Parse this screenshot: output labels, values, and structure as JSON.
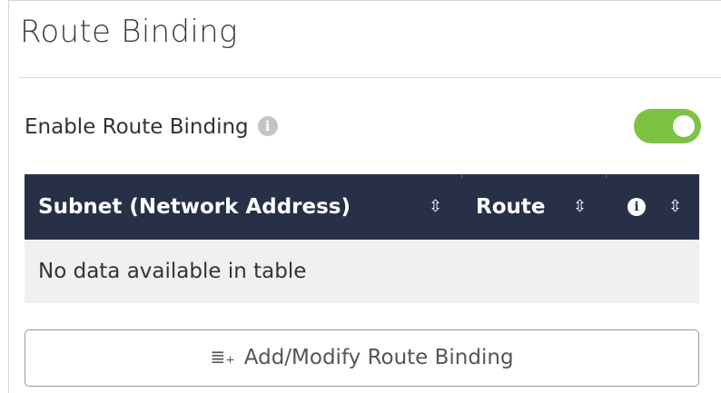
{
  "panel": {
    "title": "Route Binding"
  },
  "enable_route_binding": {
    "label": "Enable Route Binding",
    "info_icon": "info-circle-icon",
    "toggle_on": true,
    "toggle_color": "#7dc242"
  },
  "table": {
    "header_color": "#283047",
    "columns": [
      {
        "label": "Subnet (Network Address)",
        "sort_icon": "sort-icon"
      },
      {
        "label": "Route",
        "sort_icon": "sort-icon"
      },
      {
        "label": "",
        "header_icon": "info-circle-icon",
        "sort_icon": "sort-icon"
      }
    ],
    "empty_message": "No data available in table"
  },
  "add_button": {
    "icon": "list-add-icon",
    "label": "Add/Modify Route Binding"
  }
}
